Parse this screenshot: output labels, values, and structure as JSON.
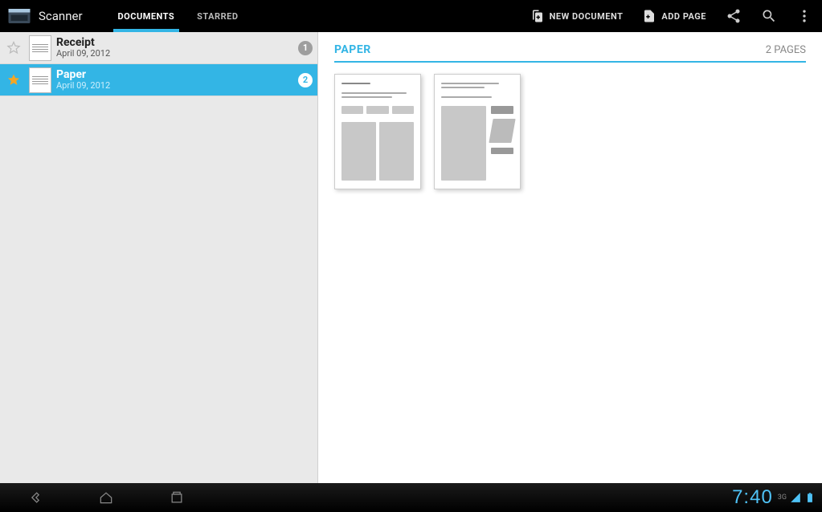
{
  "app": {
    "title": "Scanner"
  },
  "tabs": {
    "documents": "DOCUMENTS",
    "starred": "STARRED",
    "active": "documents"
  },
  "actions": {
    "new_document": "NEW DOCUMENT",
    "add_page": "ADD PAGE"
  },
  "documents": [
    {
      "title": "Receipt",
      "date": "April 09, 2012",
      "count": "1",
      "starred": false,
      "selected": false
    },
    {
      "title": "Paper",
      "date": "April 09, 2012",
      "count": "2",
      "starred": true,
      "selected": true
    }
  ],
  "detail": {
    "title": "PAPER",
    "pages_label": "2 PAGES",
    "page_count": 2
  },
  "statusbar": {
    "time": "7:40",
    "network": "3G"
  }
}
